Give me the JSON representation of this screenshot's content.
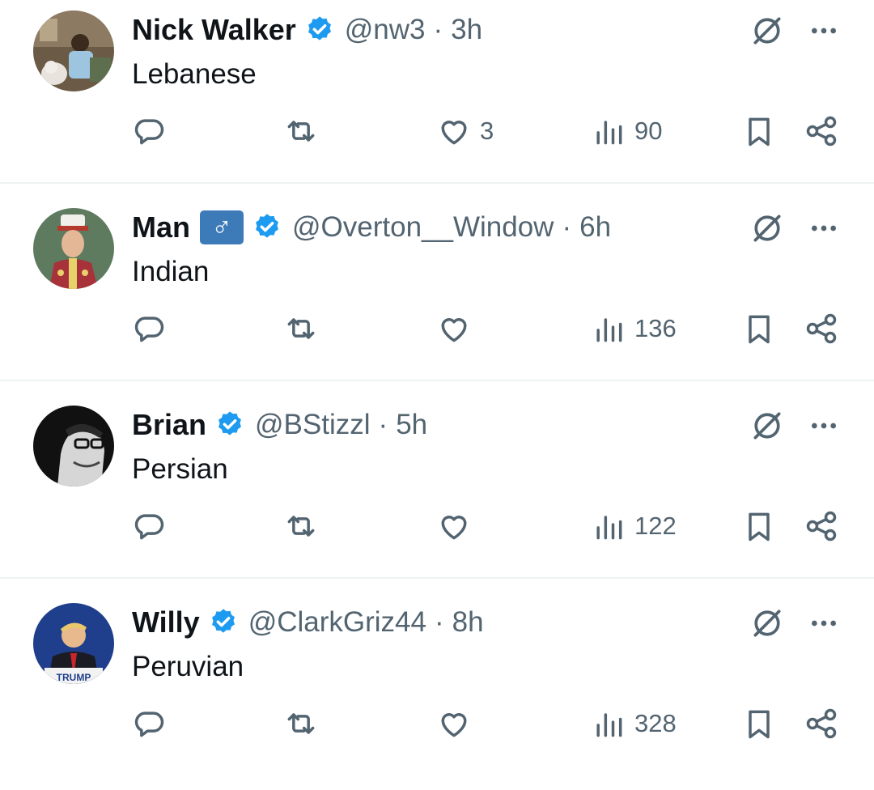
{
  "tweets": [
    {
      "name": "Nick Walker",
      "handle": "@nw3",
      "sep": "·",
      "time": "3h",
      "text": "Lebanese",
      "likes": "3",
      "views": "90",
      "avatar": "photo of man with dog"
    },
    {
      "name": "Man",
      "emoji": "♂",
      "handle": "@Overton__Window",
      "sep": "·",
      "time": "6h",
      "text": "Indian",
      "likes": "",
      "views": "136",
      "avatar": "illustrated military officer portrait"
    },
    {
      "name": "Brian",
      "handle": "@BStizzl",
      "sep": "·",
      "time": "5h",
      "text": "Persian",
      "likes": "",
      "views": "122",
      "avatar": "black and white portrait with glasses"
    },
    {
      "name": "Willy",
      "handle": "@ClarkGriz44",
      "sep": "·",
      "time": "8h",
      "text": "Peruvian",
      "likes": "",
      "views": "328",
      "avatar": "Trump photo",
      "avatar_sign": "TRUMP"
    }
  ],
  "colors": {
    "verified": "#1d9bf0",
    "muted": "#536471",
    "text": "#0f1419",
    "divider": "#eff3f4",
    "badge": "#3d7ab8"
  }
}
